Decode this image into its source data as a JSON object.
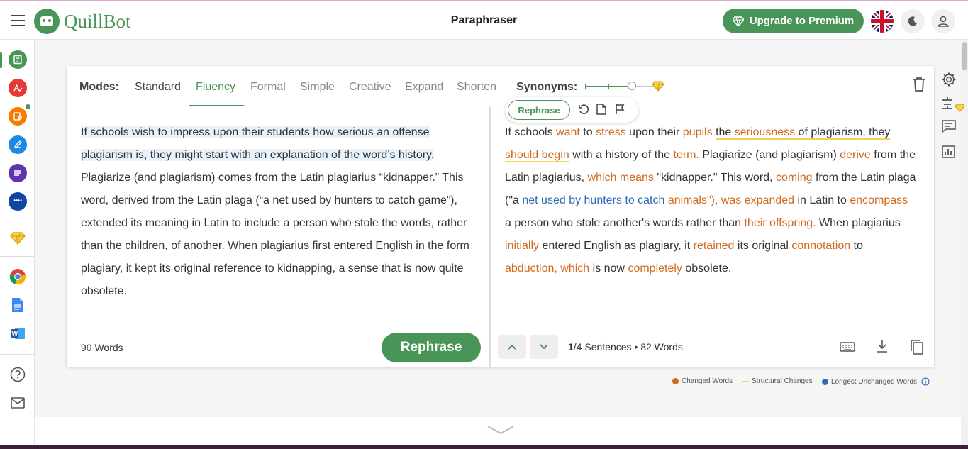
{
  "header": {
    "logo_text": "QuillBot",
    "title": "Paraphraser",
    "premium_label": "Upgrade to Premium",
    "icons": [
      "hamburger-icon",
      "flag-uk-icon",
      "moon-icon",
      "user-icon",
      "diamond-icon"
    ]
  },
  "sidebar": {
    "items": [
      {
        "name": "paraphraser",
        "color": "#499557",
        "active": true
      },
      {
        "name": "grammar-checker",
        "color": "#e53935"
      },
      {
        "name": "plagiarism-checker",
        "color": "#f57c00",
        "badge": true
      },
      {
        "name": "co-writer",
        "color": "#1e88e5"
      },
      {
        "name": "summarizer",
        "color": "#5e35b1"
      },
      {
        "name": "citation-generator",
        "color": "#0d47a1"
      },
      {
        "name": "premium",
        "color": "#f4b400"
      },
      {
        "name": "chrome-extension",
        "color": "#db4437"
      },
      {
        "name": "google-docs",
        "color": "#4285f4"
      },
      {
        "name": "word",
        "color": "#2b579a"
      },
      {
        "name": "help",
        "color": "#555"
      },
      {
        "name": "mail",
        "color": "#555"
      }
    ]
  },
  "modes": {
    "label": "Modes:",
    "items": [
      "Standard",
      "Fluency",
      "Formal",
      "Simple",
      "Creative",
      "Expand",
      "Shorten"
    ],
    "active": "Fluency"
  },
  "synonyms": {
    "label": "Synonyms:",
    "level": 0.66
  },
  "input": {
    "highlighted": "If schools wish to impress upon their students how serious an offense plagiarism is, they might start with an explanation of the word’s history.",
    "rest": " Plagiarize (and plagiarism) comes from the Latin plagiarius “kidnapper.” This word, derived from the Latin plaga (“a net used by hunters to catch game”), extended its meaning in Latin to include a person who stole the words, rather than the children, of another. When plagiarius first entered English in the form plagiary, it kept its original reference to kidnapping, a sense that is now quite obsolete.",
    "word_count": "90 Words",
    "rephrase_label": "Rephrase"
  },
  "float_toolbar": {
    "rephrase_label": "Rephrase"
  },
  "output": {
    "segments": [
      {
        "t": "If schools ",
        "c": ""
      },
      {
        "t": "want",
        "c": "ch"
      },
      {
        "t": " to ",
        "c": ""
      },
      {
        "t": "stress",
        "c": "ch"
      },
      {
        "t": " upon their ",
        "c": ""
      },
      {
        "t": "pupils",
        "c": "ch"
      },
      {
        "t": " ",
        "c": ""
      },
      {
        "t": "the ",
        "c": "su"
      },
      {
        "t": "seriousness",
        "c": "ch su"
      },
      {
        "t": " of plagiarism, they ",
        "c": "su"
      },
      {
        "t": "should begin",
        "c": "ch su"
      },
      {
        "t": " with a history of the ",
        "c": ""
      },
      {
        "t": "term.",
        "c": "ch"
      },
      {
        "t": " Plagiarize (and plagiarism) ",
        "c": ""
      },
      {
        "t": "derive",
        "c": "ch"
      },
      {
        "t": " from the Latin plagiarius, ",
        "c": ""
      },
      {
        "t": "which means",
        "c": "ch"
      },
      {
        "t": " \"kidnapper.\" This word, ",
        "c": ""
      },
      {
        "t": "coming",
        "c": "ch"
      },
      {
        "t": " from the Latin plaga (\"a ",
        "c": ""
      },
      {
        "t": "net used by hunters to catch",
        "c": "lu"
      },
      {
        "t": " ",
        "c": ""
      },
      {
        "t": "animals\"), was expanded",
        "c": "ch"
      },
      {
        "t": " in Latin to ",
        "c": ""
      },
      {
        "t": "encompass",
        "c": "ch"
      },
      {
        "t": " a person who stole another's words rather than ",
        "c": ""
      },
      {
        "t": "their offspring.",
        "c": "ch"
      },
      {
        "t": " When plagiarius ",
        "c": ""
      },
      {
        "t": "initially",
        "c": "ch"
      },
      {
        "t": " entered English as plagiary, it ",
        "c": ""
      },
      {
        "t": "retained",
        "c": "ch"
      },
      {
        "t": " its original ",
        "c": ""
      },
      {
        "t": "connotation",
        "c": "ch"
      },
      {
        "t": " to ",
        "c": ""
      },
      {
        "t": "abduction, which",
        "c": "ch"
      },
      {
        "t": " is now ",
        "c": ""
      },
      {
        "t": "completely",
        "c": "ch"
      },
      {
        "t": " obsolete.",
        "c": ""
      }
    ],
    "sentence_index": "1",
    "sentence_rest": "/4 Sentences",
    "bullet": "•",
    "word_count": "82 Words"
  },
  "legend": {
    "changed": "Changed Words",
    "structural": "Structural Changes",
    "longest": "Longest Unchanged Words",
    "colors": {
      "changed": "#d2691e",
      "structural": "#f2d35a",
      "longest": "#2e6cb5"
    }
  }
}
